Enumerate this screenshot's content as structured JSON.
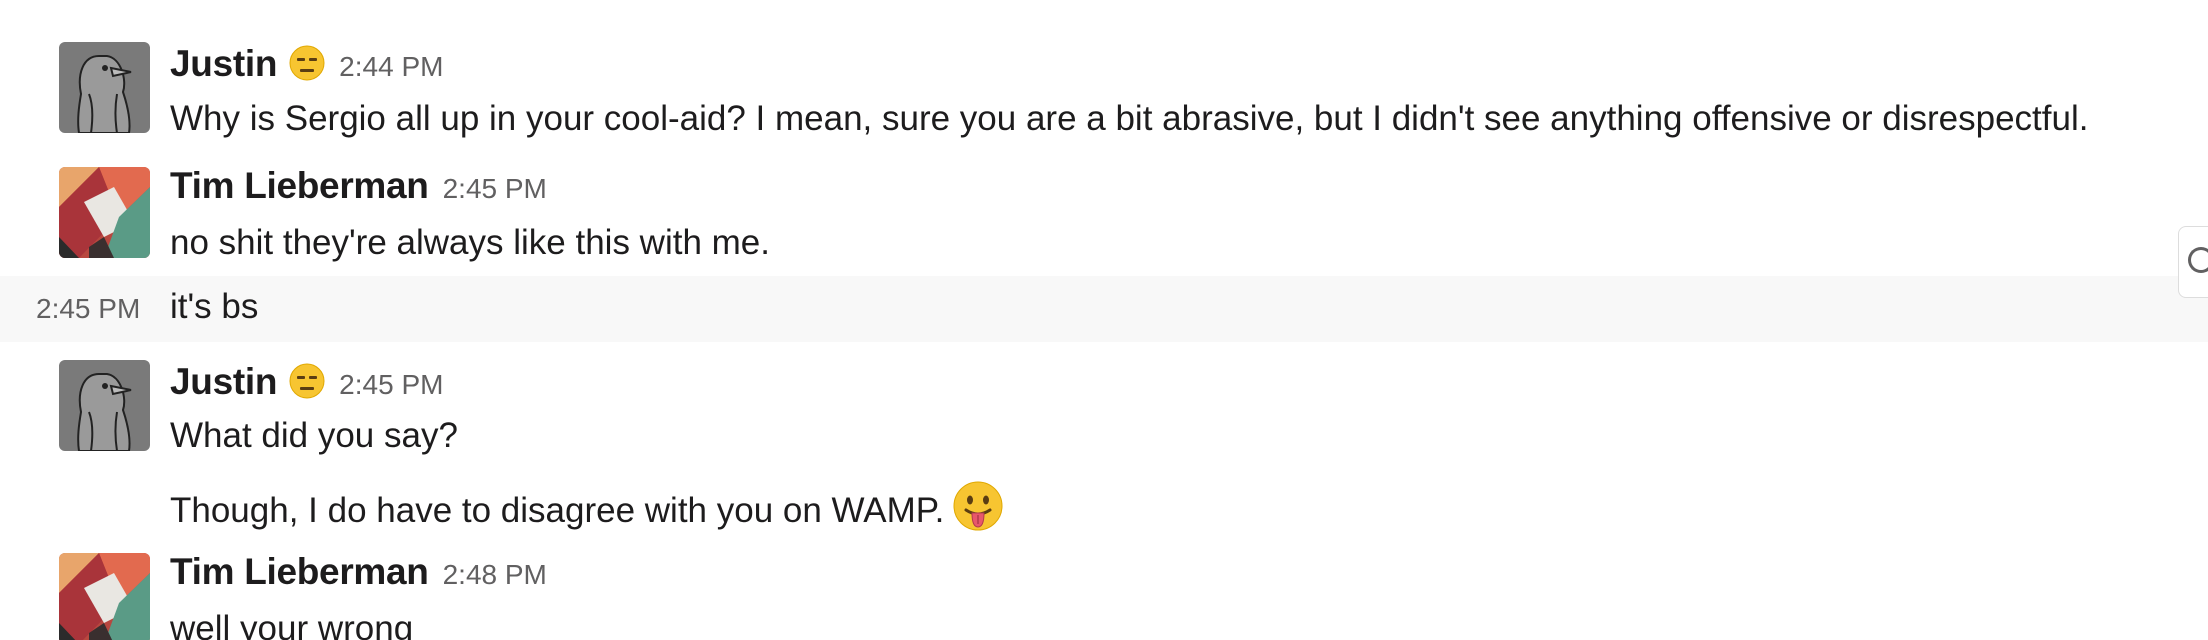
{
  "messages": [
    {
      "author": "Justin",
      "avatar_icon": "penguin-avatar",
      "status_emoji": "expressionless-face-emoji",
      "time": "2:44 PM",
      "text": "Why is Sergio all up in your cool-aid? I mean, sure you are a bit abrasive, but I didn't see anything offensive or disrespectful."
    },
    {
      "author": "Tim Lieberman",
      "avatar_icon": "slack-pattern-avatar",
      "time": "2:45 PM",
      "text": "no shit they're always like this with me."
    },
    {
      "continuation": true,
      "time": "2:45 PM",
      "text": "it's bs"
    },
    {
      "author": "Justin",
      "avatar_icon": "penguin-avatar",
      "status_emoji": "expressionless-face-emoji",
      "time": "2:45 PM",
      "text": "What did you say?",
      "followup_text": "Though, I do have to disagree with you on WAMP.",
      "followup_emoji": "tongue-out-face-emoji"
    },
    {
      "author": "Tim Lieberman",
      "avatar_icon": "slack-pattern-avatar",
      "time": "2:48 PM",
      "text": "well your wrong"
    }
  ],
  "colors": {
    "text": "#1d1c1d",
    "timestamp": "#616061",
    "hover_row": "#f8f8f8"
  }
}
